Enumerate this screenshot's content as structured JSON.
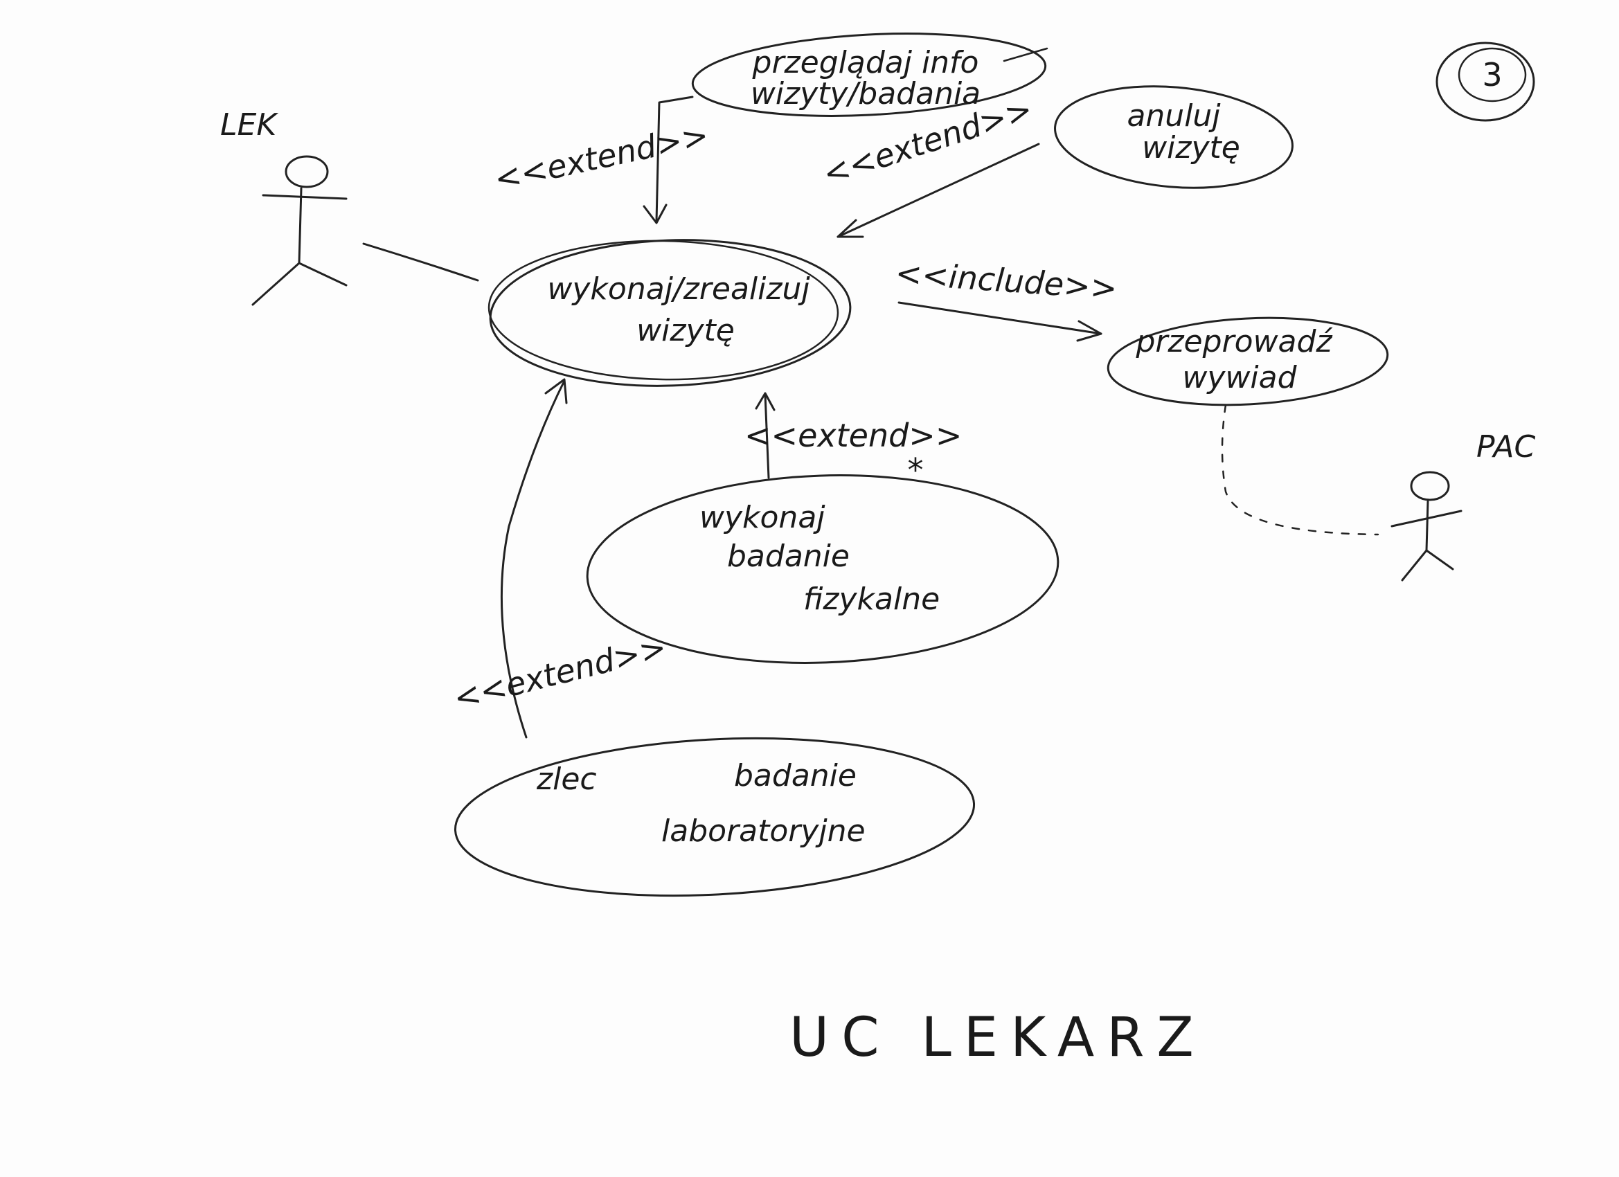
{
  "actors": {
    "lek": "LEK",
    "pac": "PAC"
  },
  "use_cases": {
    "main": {
      "line1": "wykonaj/zrealizuj",
      "line2": "wizytę"
    },
    "przegladaj": {
      "line1": "przeglądaj info",
      "line2": "wizyty/badania"
    },
    "anuluj": {
      "line1": "anuluj",
      "line2": "wizytę"
    },
    "wywiad": {
      "line1": "przeprowadź",
      "line2": "wywiad"
    },
    "fizykalne": {
      "line1": "wykonaj",
      "line2": "badanie",
      "line3": "fizykalne"
    },
    "laboratoryjne": {
      "line1": "zlec",
      "line2": "badanie",
      "line3": "laboratoryjne"
    }
  },
  "stereotypes": {
    "extend_przegladaj": "<<extend>>",
    "extend_anuluj": "<<extend>>",
    "include_wywiad": "<<include>>",
    "extend_fizykalne": "<<extend>>",
    "extend_laboratoryjne": "<<extend>>"
  },
  "multiplicity": "*",
  "page_number": "3",
  "title": "UC LEKARZ",
  "colors": {
    "ink": "#222222",
    "paper": "#fdfdfd"
  }
}
